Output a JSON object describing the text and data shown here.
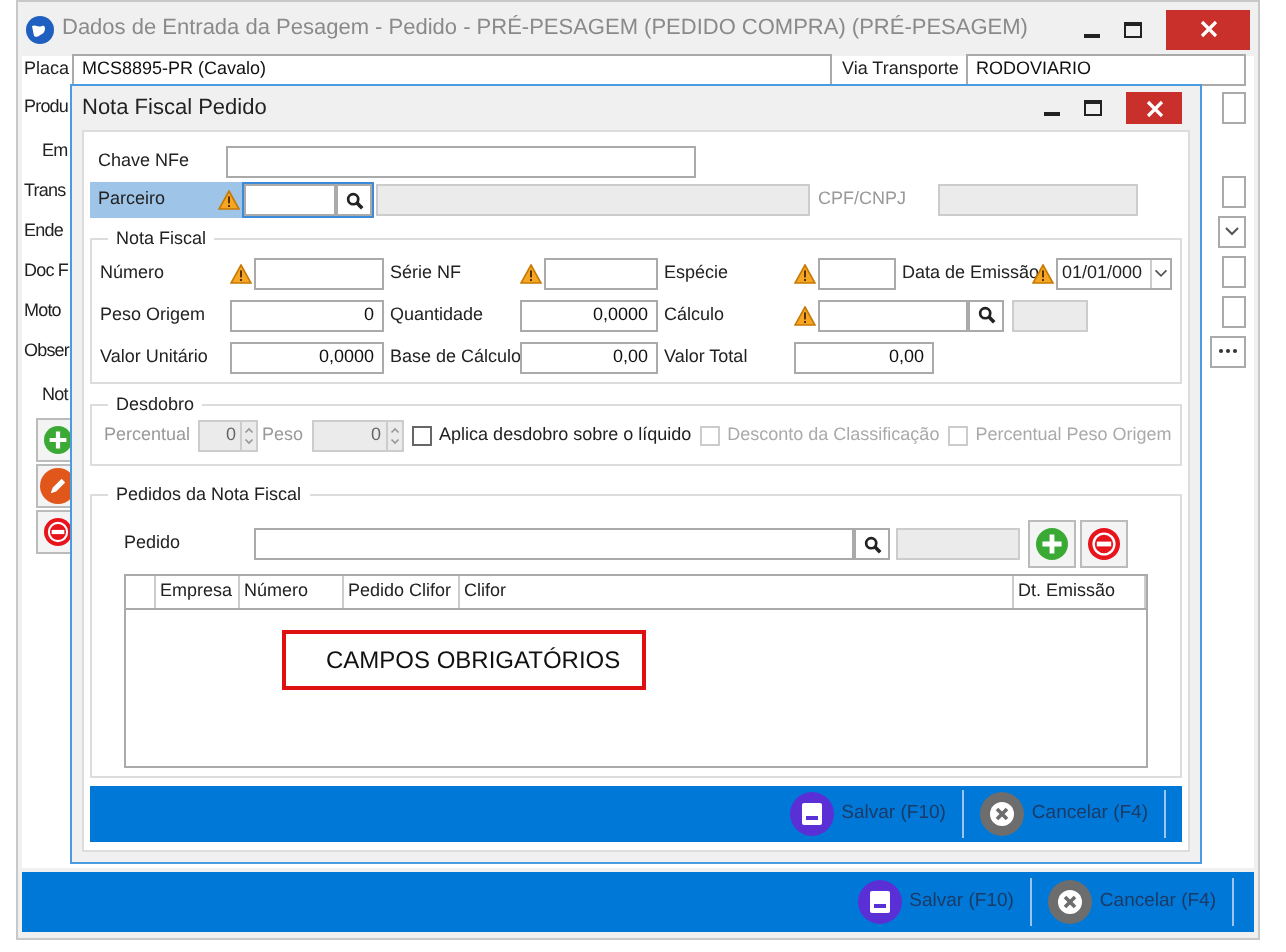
{
  "main_window": {
    "title": "Dados de Entrada da Pesagem - Pedido - PRÉ-PESAGEM (PEDIDO COMPRA) (PRÉ-PESAGEM)",
    "placa_label": "Placa",
    "placa": "MCS8895-PR (Cavalo)",
    "via_label": "Via Transporte",
    "via": "RODOVIARIO",
    "side_rows": [
      {
        "label": "Produ",
        "kind": "field"
      },
      {
        "label": "Em",
        "kind": "group"
      },
      {
        "label": "Trans",
        "kind": "field"
      },
      {
        "label": "Ende",
        "kind": "dropdown"
      },
      {
        "label": "Doc F",
        "kind": "field"
      },
      {
        "label": "Moto",
        "kind": "field"
      },
      {
        "label": "Obser",
        "kind": "ellipsis"
      },
      {
        "label": "Not",
        "kind": "group"
      }
    ],
    "buttons": [
      {
        "label": "Salvar (F10)",
        "kind": "save"
      },
      {
        "label": "Cancelar (F4)",
        "kind": "cancel"
      }
    ]
  },
  "dialog": {
    "title": "Nota Fiscal Pedido",
    "chave_label": "Chave NFe",
    "parceiro": {
      "label": "Parceiro",
      "focused": true,
      "required": true,
      "cpf_label": "CPF/CNPJ"
    },
    "nota_fiscal": {
      "title": "Nota Fiscal",
      "rows": [
        [
          {
            "label": "Número",
            "required": true,
            "kind": "text"
          },
          {
            "label": "Série NF",
            "required": true,
            "kind": "text"
          },
          {
            "label": "Espécie",
            "required": true,
            "kind": "text"
          },
          {
            "label": "Data de Emissão",
            "required": true,
            "kind": "date",
            "value": "01/01/000"
          }
        ],
        [
          {
            "label": "Peso Origem",
            "required": false,
            "kind": "text",
            "value": "0"
          },
          {
            "label": "Quantidade",
            "required": false,
            "kind": "text",
            "value": "0,0000"
          },
          {
            "label": "Cálculo",
            "required": true,
            "kind": "lookup"
          }
        ],
        [
          {
            "label": "Valor Unitário",
            "required": false,
            "kind": "text",
            "value": "0,0000"
          },
          {
            "label": "Base de Cálculo",
            "required": false,
            "kind": "text",
            "value": "0,00"
          },
          {
            "label": "Valor Total",
            "required": false,
            "kind": "text",
            "value": "0,00"
          }
        ]
      ]
    },
    "desdobro": {
      "title": "Desdobro",
      "items": [
        {
          "kind": "spinner",
          "label": "Percentual",
          "value": "0",
          "disabled": true
        },
        {
          "kind": "spinner",
          "label": "Peso",
          "value": "0",
          "disabled": true
        },
        {
          "kind": "checkbox",
          "label": "Aplica desdobro sobre o líquido",
          "checked": false,
          "disabled": false
        },
        {
          "kind": "checkbox",
          "label": "Desconto da Classificação",
          "checked": false,
          "disabled": true
        },
        {
          "kind": "checkbox",
          "label": "Percentual Peso Origem",
          "checked": false,
          "disabled": true
        }
      ]
    },
    "pedidos": {
      "title": "Pedidos da Nota Fiscal",
      "pedido_label": "Pedido",
      "columns": [
        "Empresa",
        "Número",
        "Pedido Clifor",
        "Clifor",
        "Dt. Emissão"
      ],
      "annotation": "CAMPOS OBRIGATÓRIOS"
    },
    "buttons": [
      {
        "label": "Salvar (F10)",
        "kind": "save"
      },
      {
        "label": "Cancelar (F4)",
        "kind": "cancel"
      }
    ]
  }
}
